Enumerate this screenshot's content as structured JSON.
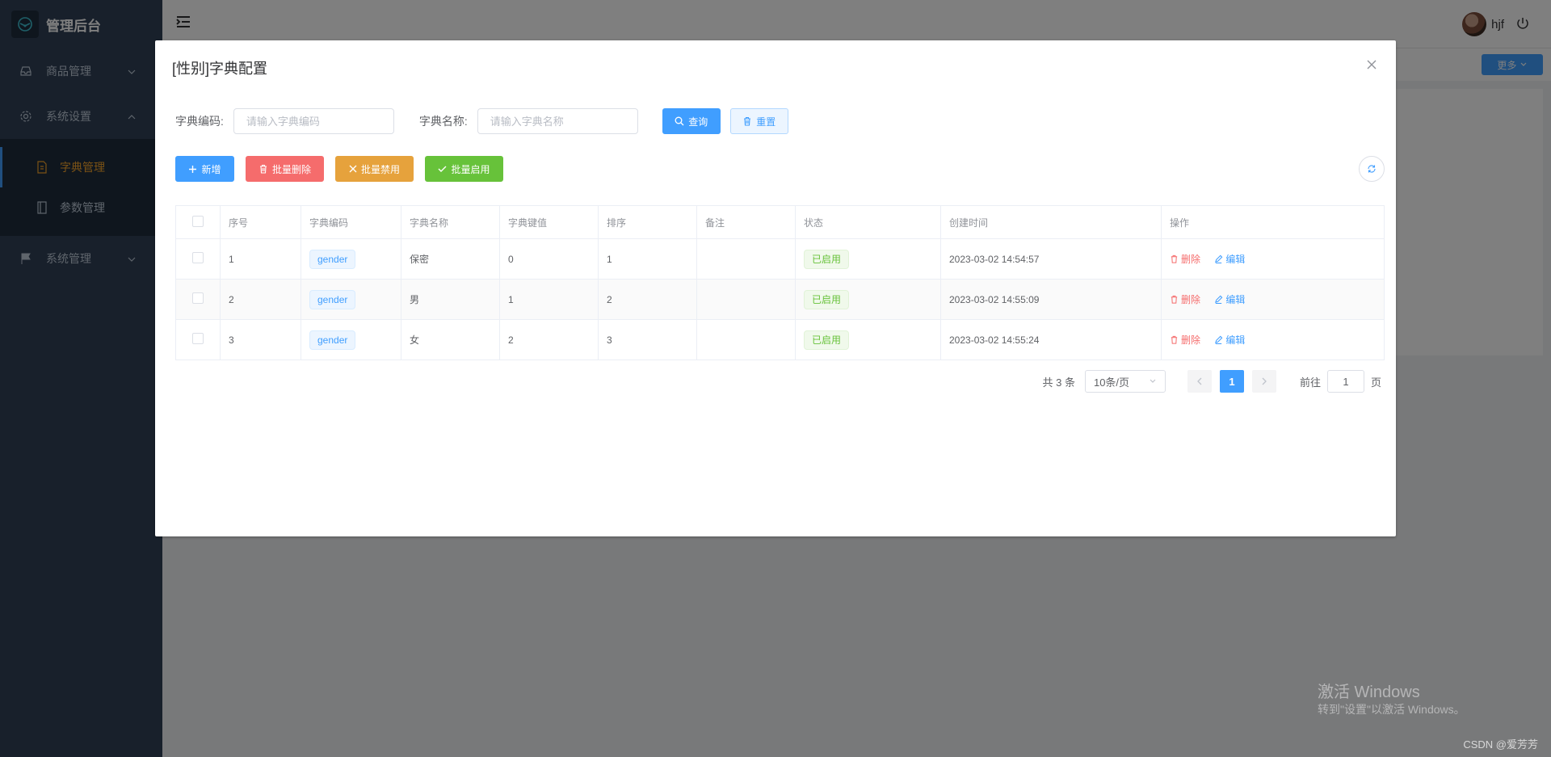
{
  "sidebar": {
    "app_title": "管理后台",
    "items": [
      {
        "label": "商品管理"
      },
      {
        "label": "系统设置"
      },
      {
        "label": "字典管理"
      },
      {
        "label": "参数管理"
      },
      {
        "label": "系统管理"
      }
    ]
  },
  "header": {
    "user_name": "hjf",
    "more_label": "更多"
  },
  "dialog": {
    "title": "[性别]字典配置",
    "search": {
      "code_label": "字典编码:",
      "code_placeholder": "请输入字典编码",
      "name_label": "字典名称:",
      "name_placeholder": "请输入字典名称",
      "query_label": "查询",
      "reset_label": "重置"
    },
    "toolbar": {
      "add_label": "新增",
      "batch_delete_label": "批量删除",
      "batch_disable_label": "批量禁用",
      "batch_enable_label": "批量启用"
    },
    "table": {
      "headers": [
        "序号",
        "字典编码",
        "字典名称",
        "字典键值",
        "排序",
        "备注",
        "状态",
        "创建时间",
        "操作"
      ],
      "rows": [
        {
          "index": "1",
          "code": "gender",
          "name": "保密",
          "value": "0",
          "sort": "1",
          "remark": "",
          "status": "已启用",
          "created": "2023-03-02 14:54:57"
        },
        {
          "index": "2",
          "code": "gender",
          "name": "男",
          "value": "1",
          "sort": "2",
          "remark": "",
          "status": "已启用",
          "created": "2023-03-02 14:55:09"
        },
        {
          "index": "3",
          "code": "gender",
          "name": "女",
          "value": "2",
          "sort": "3",
          "remark": "",
          "status": "已启用",
          "created": "2023-03-02 14:55:24"
        }
      ],
      "delete_label": "删除",
      "edit_label": "编辑"
    },
    "pagination": {
      "total_text": "共 3 条",
      "page_size": "10条/页",
      "current_page": "1",
      "goto_label": "前往",
      "goto_value": "1",
      "page_suffix": "页"
    }
  },
  "watermark": {
    "line1": "激活 Windows",
    "line2": "转到\"设置\"以激活 Windows。",
    "csdn": "CSDN @爱芳芳"
  }
}
